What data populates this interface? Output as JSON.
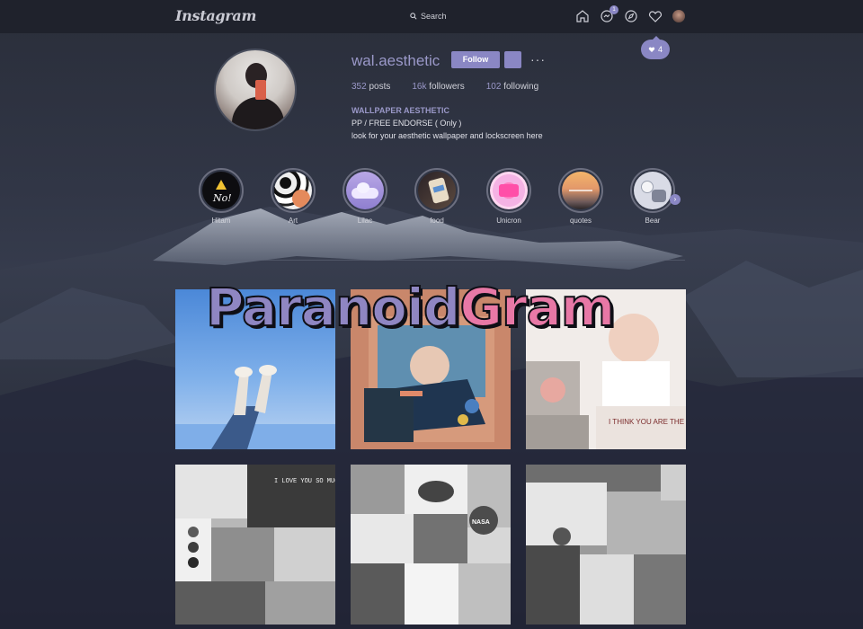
{
  "app": {
    "logo": "Instagram",
    "search_label": "Search",
    "messages_badge": "1",
    "notification_count": "4"
  },
  "profile": {
    "username": "wal.aesthetic",
    "follow_label": "Follow",
    "more_label": "···",
    "stats": {
      "posts_num": "352",
      "posts_label": "posts",
      "followers_num": "16k",
      "followers_label": "followers",
      "following_num": "102",
      "following_label": "following"
    },
    "bio": {
      "category": "WALLPAPER AESTHETIC",
      "line1": "PP / FREE ENDORSE ( Only )",
      "line2": "look for your aesthetic wallpaper and lockscreen here"
    }
  },
  "highlights": [
    {
      "label": "Hitam",
      "icon": "warning-icon"
    },
    {
      "label": "Art"
    },
    {
      "label": "Lilac"
    },
    {
      "label": "food"
    },
    {
      "label": "Unicron"
    },
    {
      "label": "quotes"
    },
    {
      "label": "Bear"
    }
  ],
  "overlay": {
    "word1": "Paranoid",
    "word2": "Gram"
  },
  "posts": [
    {
      "caption": ""
    },
    {
      "caption": ""
    },
    {
      "caption": "I THINK YOU ARE THE SWEETEST THING"
    },
    {
      "caption": "I LOVE YOU SO MUCH"
    },
    {
      "caption": "NASA"
    },
    {
      "caption": ""
    }
  ],
  "colors": {
    "accent": "#8a87c4",
    "wordmark_purple": "#8f86c2",
    "wordmark_pink": "#e878a6",
    "topbar": "#1f222c"
  }
}
